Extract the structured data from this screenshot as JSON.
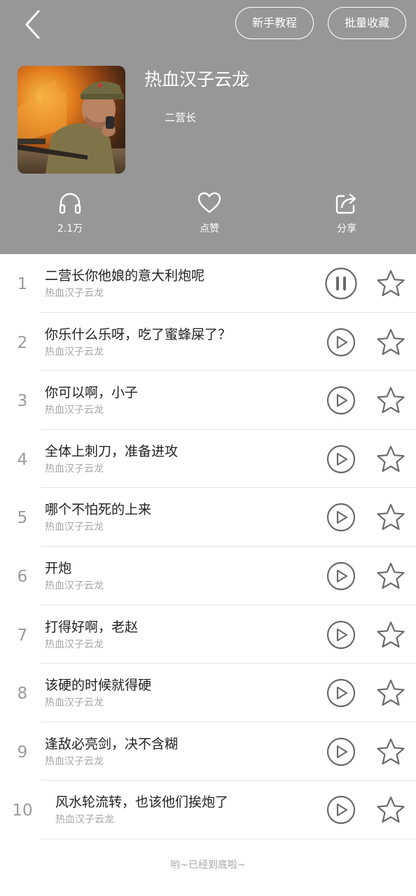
{
  "header": {
    "tutorial_label": "新手教程",
    "batch_collect_label": "批量收藏",
    "album_title": "热血汉子云龙",
    "album_author": "二营长",
    "stats": {
      "listens": "2.1万",
      "like_label": "点赞",
      "share_label": "分享"
    }
  },
  "tracks": [
    {
      "num": "1",
      "title": "二营长你他娘的意大利炮呢",
      "sub": "热血汉子云龙",
      "state": "playing"
    },
    {
      "num": "2",
      "title": "你乐什么乐呀，吃了蜜蜂屎了？",
      "sub": "热血汉子云龙",
      "state": "paused"
    },
    {
      "num": "3",
      "title": "你可以啊，小子",
      "sub": "热血汉子云龙",
      "state": "paused"
    },
    {
      "num": "4",
      "title": "全体上刺刀，准备进攻",
      "sub": "热血汉子云龙",
      "state": "paused"
    },
    {
      "num": "5",
      "title": "哪个不怕死的上来",
      "sub": "热血汉子云龙",
      "state": "paused"
    },
    {
      "num": "6",
      "title": "开炮",
      "sub": "热血汉子云龙",
      "state": "paused"
    },
    {
      "num": "7",
      "title": "打得好啊，老赵",
      "sub": "热血汉子云龙",
      "state": "paused"
    },
    {
      "num": "8",
      "title": "该硬的时候就得硬",
      "sub": "热血汉子云龙",
      "state": "paused"
    },
    {
      "num": "9",
      "title": "逢敌必亮剑，决不含糊",
      "sub": "热血汉子云龙",
      "state": "paused"
    },
    {
      "num": "10",
      "title": "风水轮流转，也该他们挨炮了",
      "sub": "热血汉子云龙",
      "state": "paused"
    }
  ],
  "footer_text": "哟~已经到底啦~",
  "colors": {
    "header_bg": "#979797",
    "icon_gray": "#6b6b6b",
    "title_text": "#222222",
    "sub_text": "#a6a6a6"
  },
  "icons": {
    "back": "chevron-left-icon",
    "listens": "headphones-icon",
    "like": "heart-icon",
    "share": "share-icon",
    "playing": "pause-icon",
    "paused": "play-icon",
    "favorite": "star-icon"
  }
}
